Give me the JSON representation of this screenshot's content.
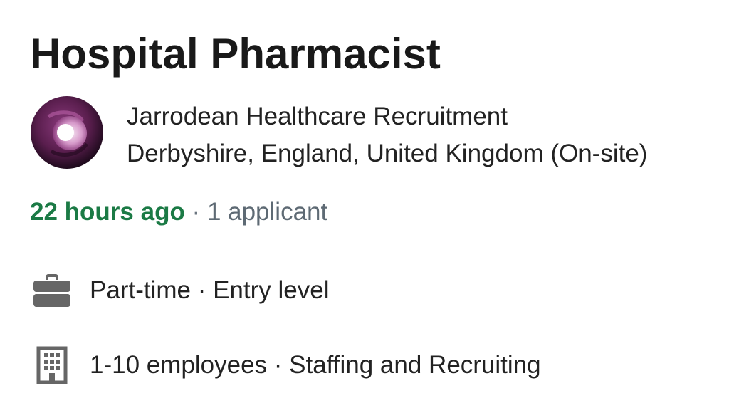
{
  "job": {
    "title": "Hospital Pharmacist",
    "company": "Jarrodean Healthcare Recruitment",
    "location": "Derbyshire, England, United Kingdom (On-site)",
    "posted": "22 hours ago",
    "separator": " · ",
    "applicants": "1 applicant"
  },
  "details": {
    "job_type": {
      "icon": "briefcase-icon",
      "text": "Part-time · Entry level"
    },
    "company_info": {
      "icon": "building-icon",
      "text": "1-10 employees · Staffing and Recruiting"
    }
  },
  "colors": {
    "posted_green": "#1b7a45",
    "muted_gray": "#5e6a74",
    "logo_purple": "#5a1e4e",
    "icon_gray": "#666666"
  }
}
